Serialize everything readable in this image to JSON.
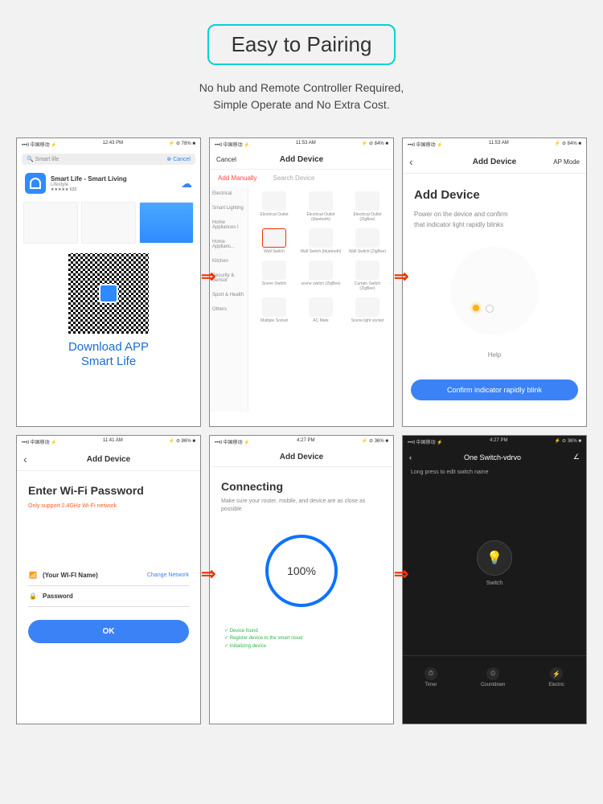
{
  "hero": {
    "title": "Easy to Pairing",
    "line1": "No hub and Remote Controller Required,",
    "line2": "Simple Operate and No Extra Cost."
  },
  "s1": {
    "carrier": "•••ll 中国移动 ⚡",
    "time": "12:43 PM",
    "right": "⚡ ⊘ 78% ■",
    "search_placeholder": "🔍 Smart life",
    "cancel": "⊗ Cancel",
    "app_name": "Smart Life - Smart Living",
    "app_cat": "Lifestyle",
    "stars": "★★★★★ 633",
    "dl_line1": "Download APP",
    "dl_line2": "Smart Life"
  },
  "s2": {
    "carrier": "•••ll 中国移动 ⚡",
    "time": "11:53 AM",
    "right": "⚡ ⊘ 84% ■",
    "cancel": "Cancel",
    "title": "Add Device",
    "tab_add": "Add Manually",
    "tab_search": "Search Device",
    "sidebar": [
      "Electrical",
      "Smart Lighting",
      "Home Appliances I",
      "Home Applianc...",
      "Kitchen",
      "Security & Sensor",
      "Sport & Health",
      "Others"
    ],
    "grid": [
      [
        "Electrical Outlet",
        "Electrical Outlet (bluetooth)",
        "Electrical Outlet (ZigBee)"
      ],
      [
        "Wall Switch",
        "Wall Switch (bluetooth)",
        "Wall Switch (ZigBee)"
      ],
      [
        "Scene Switch",
        "scene switch (ZigBee)",
        "Curtain Switch (ZigBee)"
      ],
      [
        "Multiple Socket",
        "AC Mate",
        "Scene light socket"
      ]
    ]
  },
  "s3": {
    "carrier": "•••ll 中国移动 ⚡",
    "time": "11:53 AM",
    "right": "⚡ ⊘ 84% ■",
    "nav_title": "Add Device",
    "nav_right": "AP Mode",
    "title": "Add Device",
    "desc1": "Power on the device and confirm",
    "desc2": "that indicator light rapidly blinks",
    "help": "Help",
    "button": "Confirm indicator rapidly blink"
  },
  "s4": {
    "carrier": "•••ll 中国移动 ⚡",
    "time": "11:41 AM",
    "right": "⚡ ⊘ 86% ■",
    "nav_title": "Add Device",
    "title": "Enter Wi-Fi Password",
    "warn": "Only support 2.4GHz Wi-Fi network",
    "wifi_name": "(Your WI-FI Name)",
    "change": "Change Network",
    "password": "Password",
    "ok": "OK"
  },
  "s5": {
    "carrier": "•••ll 中国移动 ⚡",
    "time": "4:27 PM",
    "right": "⚡ ⊘ 36% ■",
    "nav_title": "Add Device",
    "title": "Connecting",
    "desc": "Make sure your router, mobile, and device are as close as possible",
    "percent": "100%",
    "check1": "Device found",
    "check2": "Register device to the smart cloud",
    "check3": "Initializing device"
  },
  "s6": {
    "carrier": "•••ll 中国移动 ⚡",
    "time": "4:27 PM",
    "right": "⚡ ⊘ 36% ■",
    "title": "One Switch-vdrvo",
    "hint": "Long press to edit switch name",
    "switch": "Switch",
    "tabs": [
      {
        "icon": "⏱",
        "label": "Timer"
      },
      {
        "icon": "⏲",
        "label": "Countdown"
      },
      {
        "icon": "⚡",
        "label": "Electric"
      }
    ]
  }
}
